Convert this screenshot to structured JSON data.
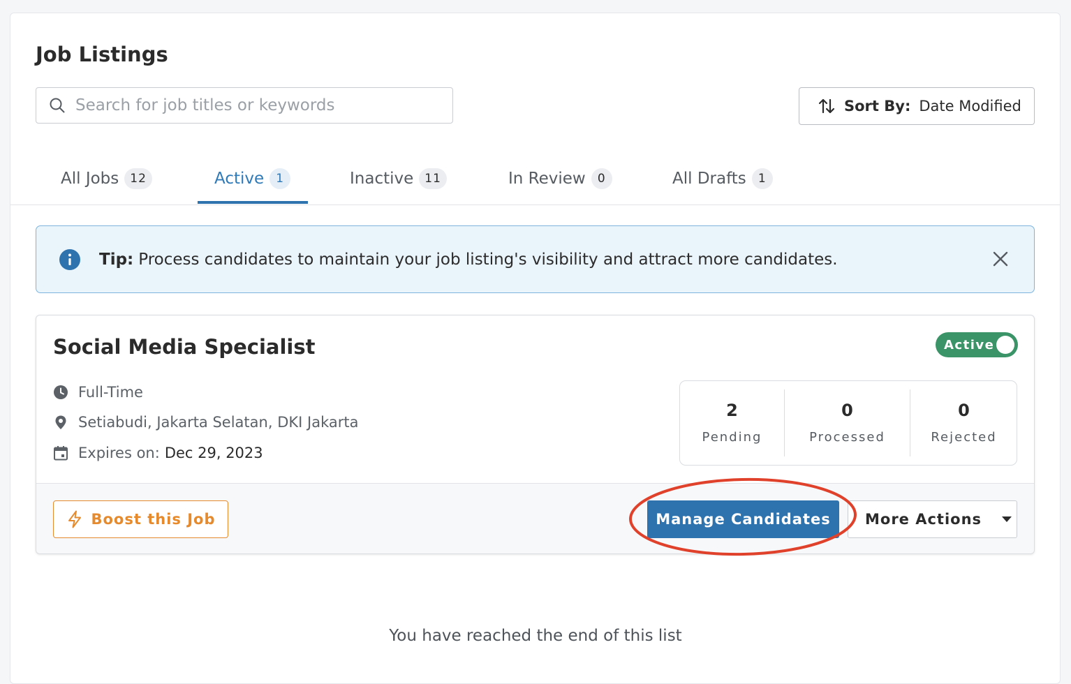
{
  "page": {
    "title": "Job Listings"
  },
  "search": {
    "placeholder": "Search for job titles or keywords",
    "value": ""
  },
  "sort": {
    "label": "Sort By:",
    "value": "Date Modified"
  },
  "tabs": [
    {
      "label": "All Jobs",
      "count": "12"
    },
    {
      "label": "Active",
      "count": "1",
      "active": true
    },
    {
      "label": "Inactive",
      "count": "11"
    },
    {
      "label": "In Review",
      "count": "0"
    },
    {
      "label": "All Drafts",
      "count": "1"
    }
  ],
  "tip": {
    "strong": "Tip:",
    "text": "Process candidates to maintain your job listing's visibility and attract more candidates."
  },
  "job": {
    "title": "Social Media Specialist",
    "status": "Active",
    "employment_type": "Full-Time",
    "location": "Setiabudi, Jakarta Selatan, DKI Jakarta",
    "expires_label": "Expires on:",
    "expires_value": "Dec 29, 2023",
    "stats": [
      {
        "value": "2",
        "label": "Pending"
      },
      {
        "value": "0",
        "label": "Processed"
      },
      {
        "value": "0",
        "label": "Rejected"
      }
    ],
    "boost_label": "Boost this Job",
    "manage_label": "Manage Candidates",
    "more_label": "More Actions"
  },
  "footer": {
    "end_text": "You have reached the end of this list"
  },
  "colors": {
    "primary": "#2f73ae",
    "active_tab": "#2f7ab8",
    "status_green": "#3b9468",
    "boost_orange": "#e68a2e",
    "annotation_red": "#e0412b",
    "tip_bg": "#eaf4fb",
    "tip_border": "#7db3dd"
  },
  "icons": {
    "search": "search-icon",
    "sort": "sort-arrows-icon",
    "info": "info-icon",
    "close": "close-icon",
    "clock": "clock-icon",
    "location": "location-pin-icon",
    "calendar": "calendar-icon",
    "lightning": "lightning-icon",
    "caret": "caret-down-icon"
  }
}
